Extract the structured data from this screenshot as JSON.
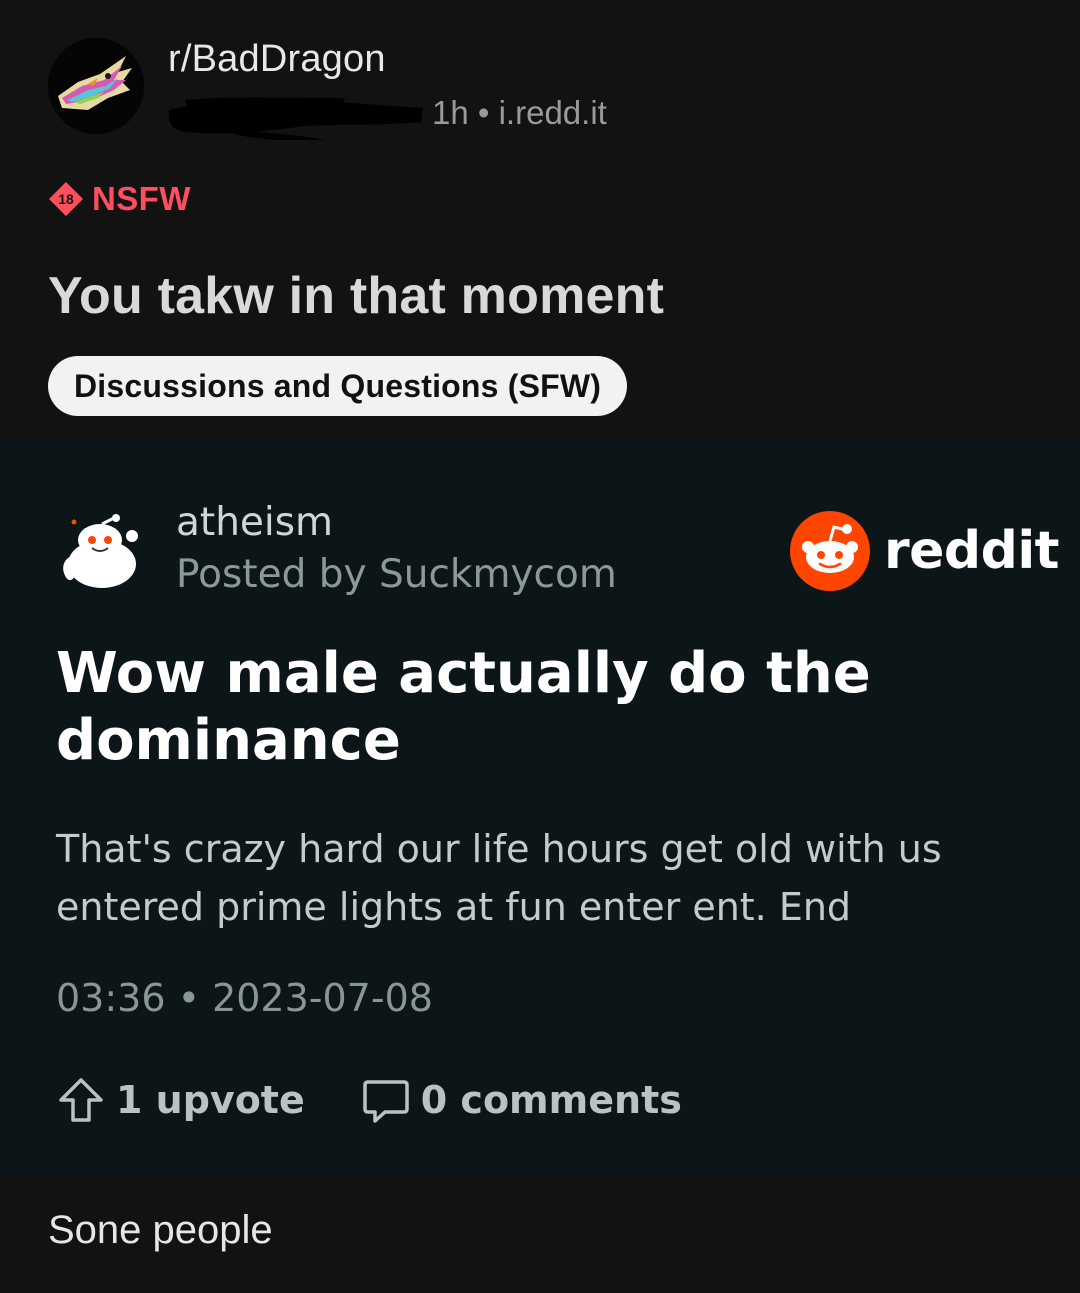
{
  "post": {
    "subreddit": "r/BadDragon",
    "meta": "1h • i.redd.it",
    "nsfw_badge": "18",
    "nsfw_label": "NSFW",
    "title": "You takw in that moment",
    "flair": "Discussions and Questions (SFW)"
  },
  "embed": {
    "subreddit": "atheism",
    "posted_by": "Posted by Suckmycom",
    "logo_text": "reddit",
    "title": "Wow male actually do the dominance",
    "body": "That's crazy hard our life hours get old with us entered prime lights at fun enter ent. End",
    "timestamp": "03:36 • 2023-07-08",
    "upvotes": "1 upvote",
    "comments": "0 comments"
  },
  "caption": "Sone people",
  "colors": {
    "nsfw": "#ff4f5e",
    "reddit_orange": "#ff4500",
    "embed_bg": "#0c1618"
  }
}
